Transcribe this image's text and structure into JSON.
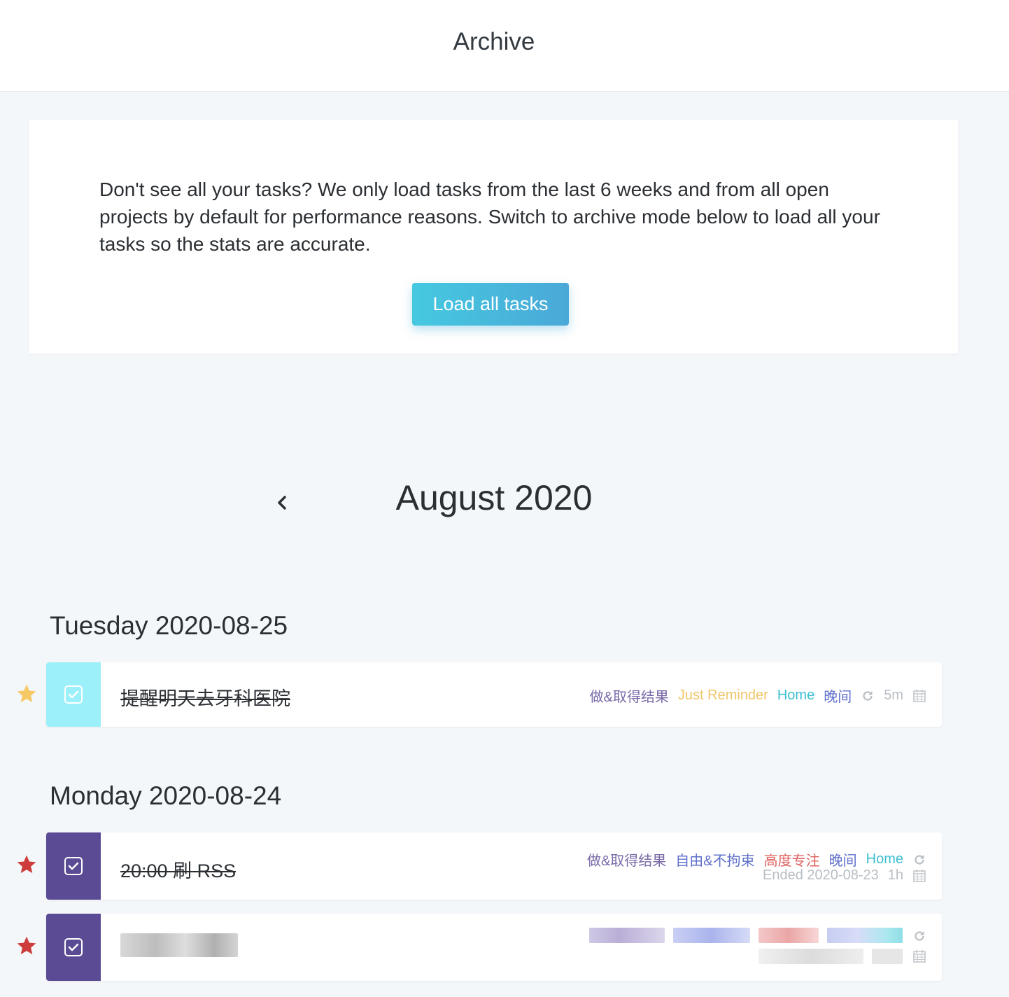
{
  "page_title": "Archive",
  "notice": {
    "text": "Don't see all your tasks? We only load tasks from the last 6 weeks and from all open projects by default for performance reasons. Switch to archive mode below to load all your tasks so the stats are accurate.",
    "button_label": "Load all tasks"
  },
  "month_label": "August 2020",
  "colors": {
    "accent_teal": "#9bf0fa",
    "accent_purple": "#5b4a94",
    "star_gold": "#f5c863",
    "star_red": "#cd3b3b",
    "tag_purple": "#7a6aa8",
    "tag_yellow": "#f0c66a",
    "tag_teal": "#3cbfd0",
    "tag_blue": "#6070cc",
    "tag_red": "#e06060"
  },
  "days": [
    {
      "heading": "Tuesday 2020-08-25",
      "tasks": [
        {
          "name": "提醒明天去牙科医院",
          "starred": true,
          "tags": [
            "做&取得结果",
            "Just Reminder",
            "Home",
            "晚间"
          ],
          "duration": "5m"
        }
      ]
    },
    {
      "heading": "Monday 2020-08-24",
      "tasks": [
        {
          "name": "20:00 刷 RSS",
          "starred": true,
          "tags": [
            "做&取得结果",
            "自由&不拘束",
            "高度专注",
            "晚间",
            "Home"
          ],
          "ended": "Ended 2020-08-23",
          "duration": "1h"
        },
        {
          "name": "",
          "starred": true,
          "tags": [],
          "obscured": true
        }
      ]
    }
  ]
}
